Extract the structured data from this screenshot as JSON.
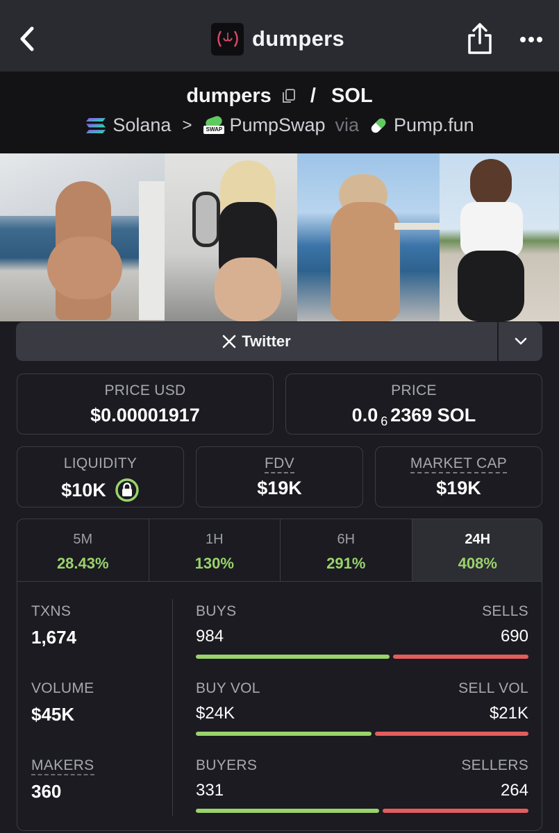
{
  "header": {
    "title": "dumpers",
    "logo_text": "(⩀)"
  },
  "pair": {
    "token": "dumpers",
    "slash": "/",
    "quote": "SOL",
    "chain": "Solana",
    "dex": "PumpSwap",
    "dex_badge": "SWAP",
    "via": "via",
    "launchpad": "Pump.fun"
  },
  "links": {
    "twitter_label": "Twitter"
  },
  "price": {
    "usd_label": "PRICE USD",
    "usd_value": "$0.00001917",
    "native_label": "PRICE",
    "native_prefix": "0.0",
    "native_zeros": "6",
    "native_rest": "2369 SOL"
  },
  "metrics": {
    "liquidity_label": "LIQUIDITY",
    "liquidity_value": "$10K",
    "fdv_label": "FDV",
    "fdv_value": "$19K",
    "mcap_label": "MARKET CAP",
    "mcap_value": "$19K"
  },
  "timeframes": [
    {
      "label": "5M",
      "change": "28.43%"
    },
    {
      "label": "1H",
      "change": "130%"
    },
    {
      "label": "6H",
      "change": "291%"
    },
    {
      "label": "24H",
      "change": "408%"
    }
  ],
  "stats": {
    "txns_label": "TXNS",
    "txns_value": "1,674",
    "volume_label": "VOLUME",
    "volume_value": "$45K",
    "makers_label": "MAKERS",
    "makers_value": "360"
  },
  "ratios": {
    "buys_label": "BUYS",
    "buys_value": "984",
    "sells_label": "SELLS",
    "sells_value": "690",
    "buys_fraction": 0.588,
    "buyvol_label": "BUY VOL",
    "buyvol_value": "$24K",
    "sellvol_label": "SELL VOL",
    "sellvol_value": "$21K",
    "buyvol_fraction": 0.533,
    "buyers_label": "BUYERS",
    "buyers_value": "331",
    "sellers_label": "SELLERS",
    "sellers_value": "264",
    "buyers_fraction": 0.556
  },
  "colors": {
    "positive": "#9ad36b",
    "negative": "#e35d5d",
    "background": "#1b1b21"
  }
}
